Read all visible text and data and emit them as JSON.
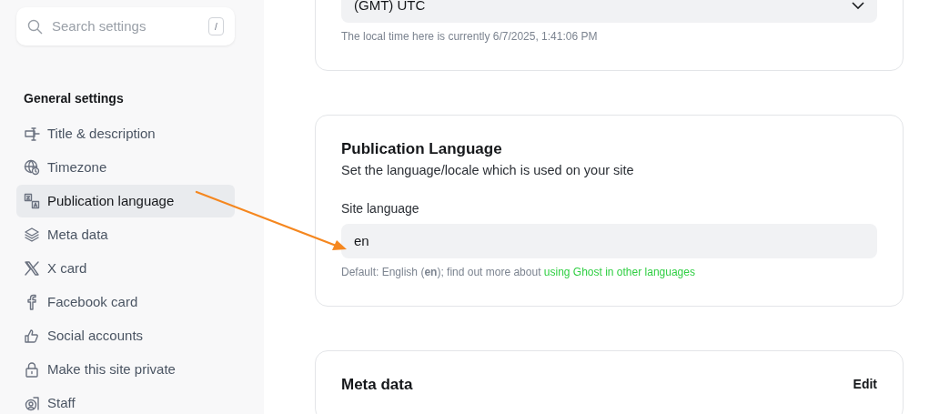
{
  "sidebar": {
    "search": {
      "placeholder": "Search settings",
      "shortcut": "/"
    },
    "section_title": "General settings",
    "items": [
      {
        "label": "Title & description",
        "selected": false
      },
      {
        "label": "Timezone",
        "selected": false
      },
      {
        "label": "Publication language",
        "selected": true
      },
      {
        "label": "Meta data",
        "selected": false
      },
      {
        "label": "X card",
        "selected": false
      },
      {
        "label": "Facebook card",
        "selected": false
      },
      {
        "label": "Social accounts",
        "selected": false
      },
      {
        "label": "Make this site private",
        "selected": false
      },
      {
        "label": "Staff",
        "selected": false
      }
    ]
  },
  "timezone_card": {
    "select_value": "(GMT) UTC",
    "hint": "The local time here is currently 6/7/2025, 1:41:06 PM"
  },
  "language_card": {
    "title": "Publication Language",
    "description": "Set the language/locale which is used on your site",
    "field_label": "Site language",
    "value": "en",
    "hint": "Default: English (**en**); find out more about",
    "link": "using Ghost in other languages"
  },
  "meta_card": {
    "title": "Meta data",
    "action": "Edit"
  }
}
